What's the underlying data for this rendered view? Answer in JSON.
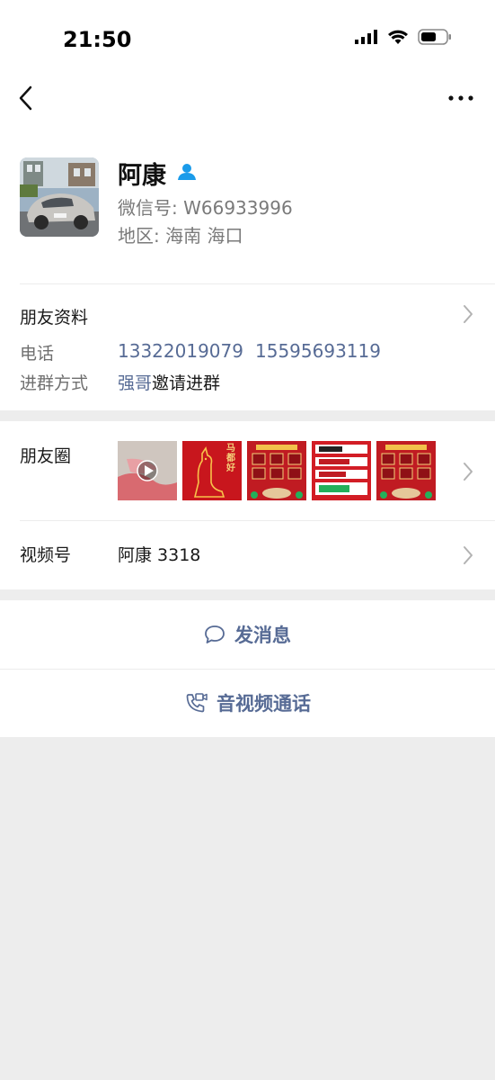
{
  "status_bar": {
    "time": "21:50"
  },
  "profile": {
    "name": "阿康",
    "wechat_id": "微信号: W66933996",
    "region": "地区: 海南 海口"
  },
  "friend_info": {
    "title": "朋友资料",
    "phone_label": "电话",
    "phones": [
      "13322019079",
      "15595693119"
    ],
    "join_label": "进群方式",
    "inviter": "强哥",
    "join_method": "邀请进群"
  },
  "moments": {
    "title": "朋友圈",
    "thumb_texts": [
      "马",
      "都",
      "好"
    ]
  },
  "channels": {
    "title": "视频号",
    "value": "阿康 3318"
  },
  "actions": {
    "message": "发消息",
    "call": "音视频通话"
  }
}
